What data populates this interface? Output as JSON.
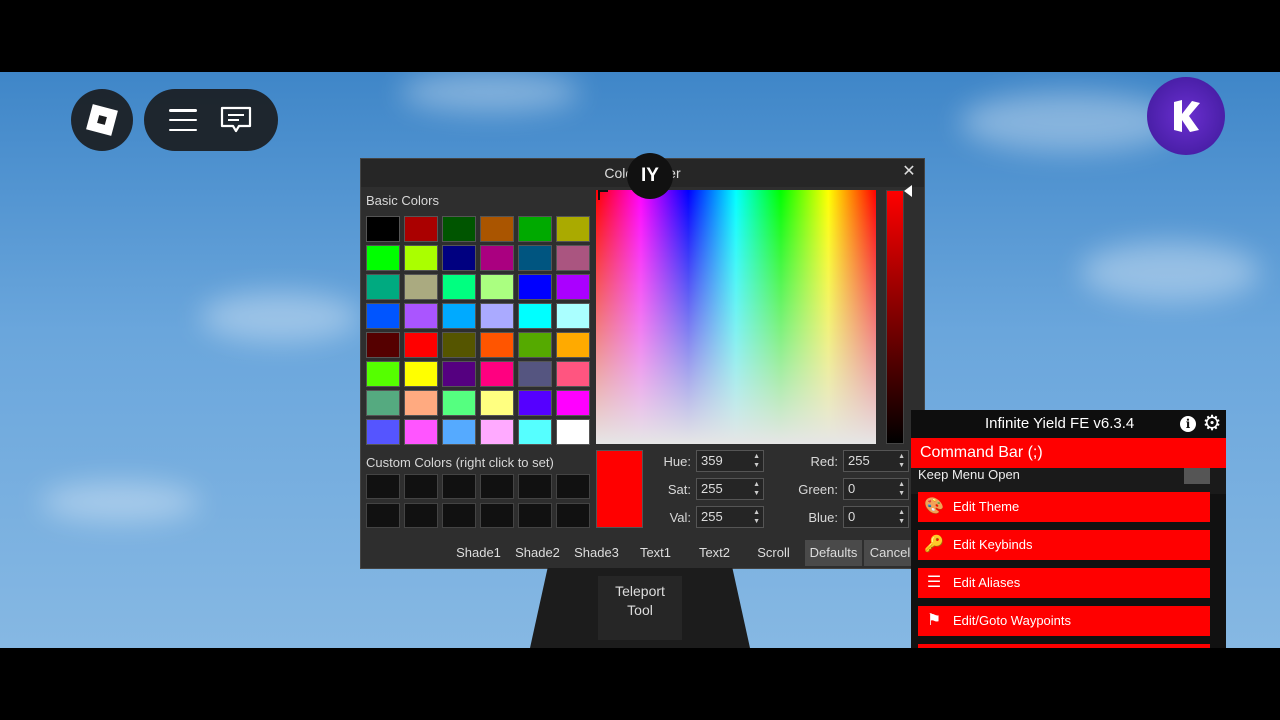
{
  "colors": {
    "accent": "#ff0000",
    "dialog_bg": "#2e2e2e",
    "selected": "#ff0000"
  },
  "topbar": {
    "roblox_icon": "roblox-logo-icon",
    "menu_icon": "hamburger-menu-icon",
    "chat_icon": "chat-icon"
  },
  "badge": {
    "letter": "K"
  },
  "picker": {
    "title": "Color Picker",
    "iy_label": "IY",
    "close": "✕",
    "basic_label": "Basic Colors",
    "custom_label": "Custom Colors (right click to set)",
    "basic_colors": [
      "#000000",
      "#aa0000",
      "#005500",
      "#aa5500",
      "#00aa00",
      "#aaaa00",
      "#00ff00",
      "#aaff00",
      "#000080",
      "#aa0080",
      "#005580",
      "#aa5580",
      "#00aa80",
      "#aaaa80",
      "#00ff80",
      "#aaff80",
      "#0000ff",
      "#aa00ff",
      "#0055ff",
      "#aa55ff",
      "#00aaff",
      "#aaaaff",
      "#00ffff",
      "#aaffff",
      "#550000",
      "#ff0000",
      "#555500",
      "#ff5500",
      "#55aa00",
      "#ffaa00",
      "#55ff00",
      "#ffff00",
      "#550080",
      "#ff0080",
      "#555580",
      "#ff5580",
      "#55aa80",
      "#ffaa80",
      "#55ff80",
      "#ffff80",
      "#5500ff",
      "#ff00ff",
      "#5555ff",
      "#ff55ff",
      "#55aaff",
      "#ffaaff",
      "#55ffff",
      "#ffffff"
    ],
    "custom_count": 12,
    "fields": {
      "hue_label": "Hue:",
      "hue": "359",
      "sat_label": "Sat:",
      "sat": "255",
      "val_label": "Val:",
      "val": "255",
      "red_label": "Red:",
      "red": "255",
      "green_label": "Green:",
      "green": "0",
      "blue_label": "Blue:",
      "blue": "0"
    },
    "buttons": [
      "Shade1",
      "Shade2",
      "Shade3",
      "Text1",
      "Text2",
      "Scroll",
      "Defaults",
      "Cancel"
    ]
  },
  "tool": {
    "line1": "Teleport",
    "line2": "Tool"
  },
  "iy": {
    "title": "Infinite Yield FE v6.3.4",
    "info_icon": "i",
    "gear_icon": "⚙",
    "command_bar": "Command Bar (;)",
    "keep_open": "Keep Menu Open",
    "items": [
      {
        "label": "Edit Theme",
        "icon": "palette-icon",
        "glyph": "🎨"
      },
      {
        "label": "Edit Keybinds",
        "icon": "key-icon",
        "glyph": "🔑"
      },
      {
        "label": "Edit Aliases",
        "icon": "list-icon",
        "glyph": "☰"
      },
      {
        "label": "Edit/Goto Waypoints",
        "icon": "flag-icon",
        "glyph": "⚑"
      }
    ]
  }
}
